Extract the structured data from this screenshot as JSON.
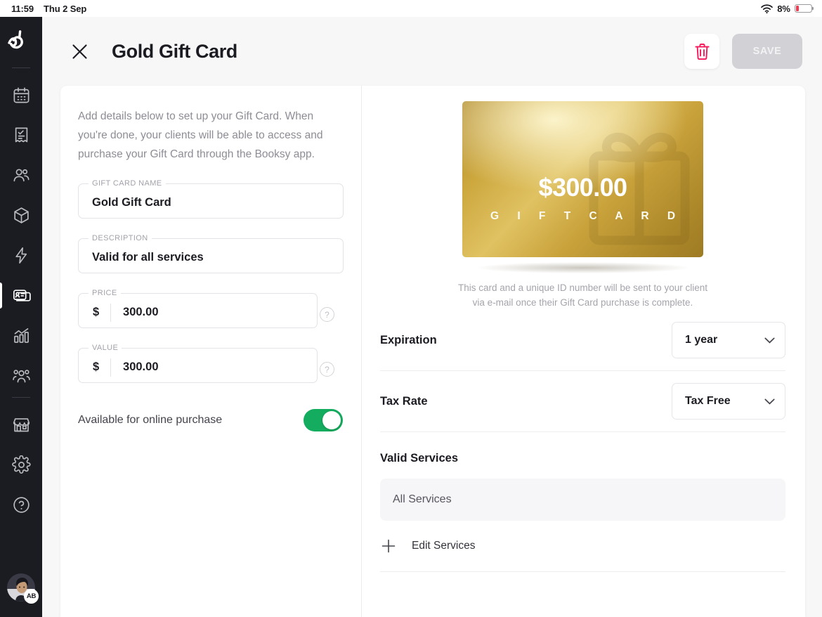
{
  "statusbar": {
    "time": "11:59",
    "date": "Thu 2 Sep",
    "battery_percent": "8%",
    "wifi_icon": "wifi-icon",
    "battery_icon": "battery-low-icon"
  },
  "sidebar": {
    "logo": "booksy-logo",
    "items": [
      {
        "name": "calendar",
        "icon": "calendar-icon",
        "active": false
      },
      {
        "name": "transactions",
        "icon": "receipt-icon",
        "active": false
      },
      {
        "name": "clients",
        "icon": "clients-icon",
        "active": false
      },
      {
        "name": "inventory",
        "icon": "box-icon",
        "active": false
      },
      {
        "name": "marketing",
        "icon": "lightning-icon",
        "active": false
      },
      {
        "name": "gift-cards",
        "icon": "gift-card-icon",
        "active": true
      },
      {
        "name": "statistics",
        "icon": "bar-chart-icon",
        "active": false
      },
      {
        "name": "staff",
        "icon": "staff-group-icon",
        "active": false
      },
      {
        "name": "business",
        "icon": "storefront-icon",
        "active": false
      },
      {
        "name": "settings",
        "icon": "gear-icon",
        "active": false
      },
      {
        "name": "help",
        "icon": "question-circle-icon",
        "active": false
      }
    ],
    "avatar_initials": "AB"
  },
  "header": {
    "close_icon": "close-icon",
    "title": "Gold Gift Card",
    "delete_icon": "trash-icon",
    "save_label": "SAVE"
  },
  "form": {
    "intro": "Add details below to set up your Gift Card. When you're done, your clients will be able to access and purchase your Gift Card through the Booksy app.",
    "name_label": "GIFT CARD NAME",
    "name_value": "Gold Gift Card",
    "description_label": "DESCRIPTION",
    "description_value": "Valid for all services",
    "price_label": "PRICE",
    "price_currency": "$",
    "price_value": "300.00",
    "value_label": "VALUE",
    "value_currency": "$",
    "value_value": "300.00",
    "help_icon": "help-circle-icon",
    "online_purchase_label": "Available for online purchase",
    "online_purchase_on": true
  },
  "preview": {
    "amount": "$300.00",
    "card_label": "G I F T   C A R D",
    "watermark_icon": "gift-box-icon",
    "note": "This card and a unique ID number will be sent to your client via e-mail once their Gift Card purchase is complete.",
    "gold_dark": "#9e7a23",
    "gold_light": "#e0c262"
  },
  "options": {
    "expiration_label": "Expiration",
    "expiration_value": "1 year",
    "tax_label": "Tax Rate",
    "tax_value": "Tax Free",
    "chevron_icon": "chevron-down-icon",
    "valid_services_title": "Valid Services",
    "all_services_chip": "All Services",
    "edit_services_label": "Edit Services",
    "plus_icon": "plus-icon"
  }
}
